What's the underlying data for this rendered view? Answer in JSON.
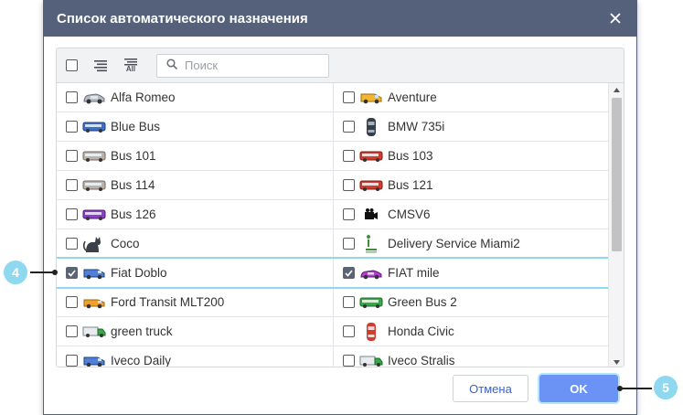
{
  "dialog": {
    "title": "Список автоматического назначения",
    "search_placeholder": "Поиск",
    "cancel_label": "Отмена",
    "ok_label": "OK",
    "toolbar": {
      "all_label": "All"
    }
  },
  "rows": [
    [
      {
        "label": "Alfa Romeo",
        "checked": false,
        "icon": "silver-car-icon"
      },
      {
        "label": "Aventure",
        "checked": false,
        "icon": "yellow-van-icon"
      }
    ],
    [
      {
        "label": "Blue Bus",
        "checked": false,
        "icon": "blue-bus-icon"
      },
      {
        "label": "BMW 735i",
        "checked": false,
        "icon": "black-car-top-icon"
      }
    ],
    [
      {
        "label": "Bus 101",
        "checked": false,
        "icon": "grey-bus-icon"
      },
      {
        "label": "Bus 103",
        "checked": false,
        "icon": "red-bus-icon"
      }
    ],
    [
      {
        "label": "Bus 114",
        "checked": false,
        "icon": "grey-bus-icon"
      },
      {
        "label": "Bus 121",
        "checked": false,
        "icon": "red-bus-icon"
      }
    ],
    [
      {
        "label": "Bus 126",
        "checked": false,
        "icon": "purple-bus-icon"
      },
      {
        "label": "CMSV6",
        "checked": false,
        "icon": "video-camera-icon"
      }
    ],
    [
      {
        "label": "Coco",
        "checked": false,
        "icon": "cat-icon"
      },
      {
        "label": "Delivery Service Miami2",
        "checked": false,
        "icon": "green-person-icon"
      }
    ],
    [
      {
        "label": "Fiat Doblo",
        "checked": true,
        "icon": "blue-van-icon"
      },
      {
        "label": "FIAT mile",
        "checked": true,
        "icon": "purple-car-icon"
      }
    ],
    [
      {
        "label": "Ford Transit MLT200",
        "checked": false,
        "icon": "orange-van-icon"
      },
      {
        "label": "Green Bus 2",
        "checked": false,
        "icon": "green-bus-icon"
      }
    ],
    [
      {
        "label": "green truck",
        "checked": false,
        "icon": "green-truck-icon"
      },
      {
        "label": "Honda Civic",
        "checked": false,
        "icon": "red-car-top-icon"
      }
    ],
    [
      {
        "label": "Iveco Daily",
        "checked": false,
        "icon": "blue-van-icon"
      },
      {
        "label": "Iveco Stralis",
        "checked": false,
        "icon": "green-truck-icon"
      }
    ]
  ],
  "callouts": {
    "left": "4",
    "right": "5"
  },
  "colors": {
    "title_bar": "#55607a",
    "accent": "#6b93f5",
    "callout": "#8fd9f0"
  }
}
